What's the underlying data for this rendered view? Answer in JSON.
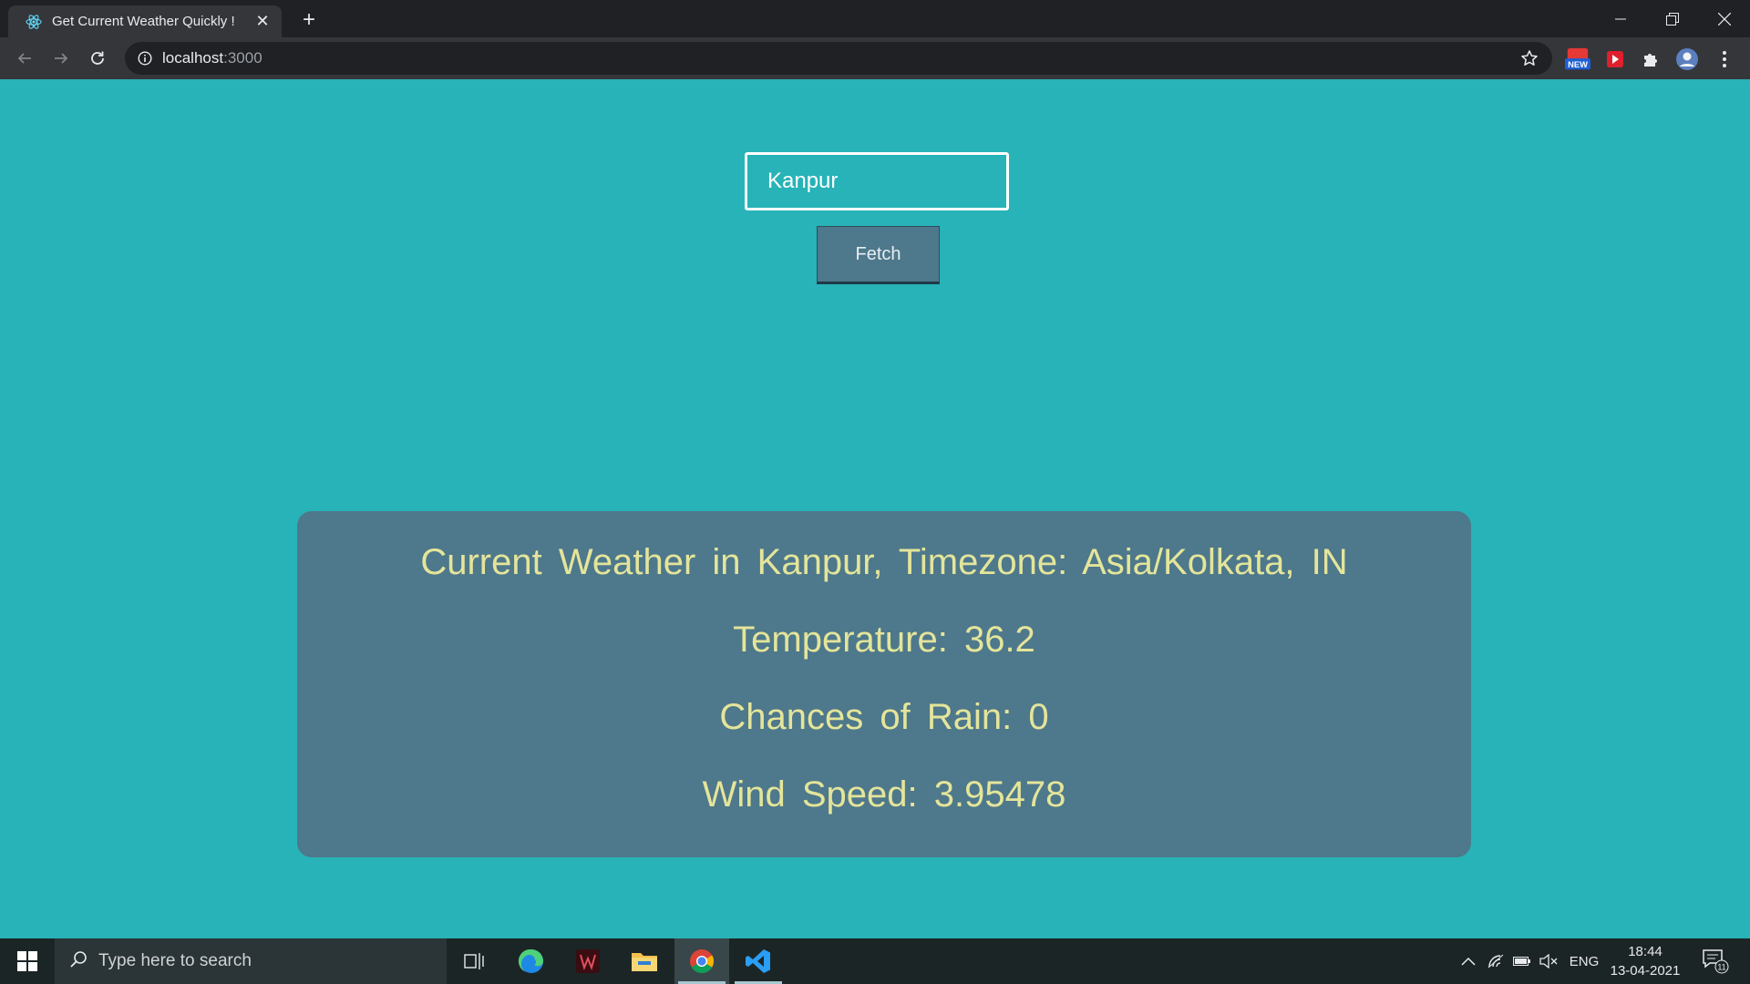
{
  "browser": {
    "tab_title": "Get Current Weather Quickly !",
    "url_host": "localhost",
    "url_port": ":3000",
    "extension_badge": "NEW"
  },
  "form": {
    "city_value": "Kanpur",
    "fetch_label": "Fetch"
  },
  "weather": {
    "title": "Current Weather in Kanpur, Timezone: Asia/Kolkata, IN",
    "temperature": "Temperature: 36.2",
    "rain": "Chances of Rain: 0",
    "wind": "Wind Speed: 3.95478"
  },
  "taskbar": {
    "search_placeholder": "Type here to search",
    "language": "ENG",
    "time": "18:44",
    "date": "13-04-2021",
    "notification_count": "11"
  },
  "colors": {
    "page_background": "#27b3b7",
    "card_background": "#4e788b",
    "card_text": "#e4e59a"
  }
}
